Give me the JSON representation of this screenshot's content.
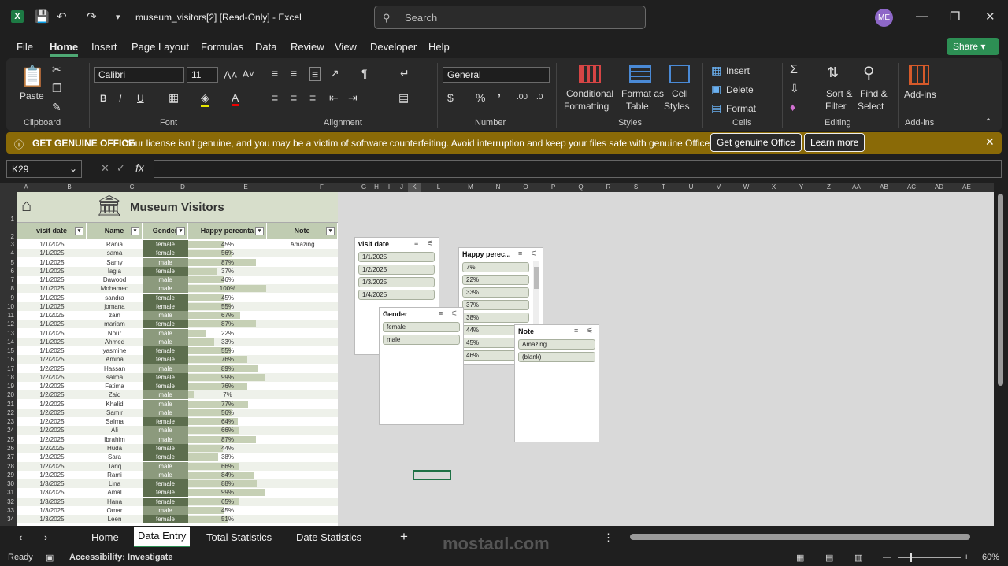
{
  "app": {
    "title": "museum_visitors[2]  [Read-Only]  -  Excel",
    "user_initials": "ME",
    "search_placeholder": "Search"
  },
  "menu": [
    "File",
    "Home",
    "Insert",
    "Page Layout",
    "Formulas",
    "Data",
    "Review",
    "View",
    "Developer",
    "Help"
  ],
  "share_label": "Share",
  "ribbon": {
    "paste": "Paste",
    "font_name": "Calibri",
    "font_size": "11",
    "number_format": "General",
    "conditional": [
      "Conditional",
      "Formatting"
    ],
    "format_table": [
      "Format as",
      "Table"
    ],
    "cell_styles": [
      "Cell",
      "Styles"
    ],
    "insert": "Insert",
    "delete": "Delete",
    "format": "Format",
    "sort_filter": [
      "Sort &",
      "Filter"
    ],
    "find_select": [
      "Find &",
      "Select"
    ],
    "addins": "Add-ins",
    "groups": [
      "Clipboard",
      "Font",
      "Alignment",
      "Number",
      "Styles",
      "Cells",
      "Editing",
      "Add-ins"
    ]
  },
  "infobar": {
    "title": "GET GENUINE OFFICE",
    "message": "Your license isn't genuine, and you may be a victim of software counterfeiting. Avoid interruption and keep your files safe with genuine Office today.",
    "get_btn": "Get genuine Office",
    "learn_btn": "Learn more"
  },
  "namebox": "K29",
  "columns": [
    "A",
    "B",
    "C",
    "D",
    "E",
    "F",
    "G",
    "H",
    "I",
    "J",
    "K",
    "L",
    "M",
    "N",
    "O",
    "P",
    "Q",
    "R",
    "S",
    "T",
    "U",
    "V",
    "W",
    "X",
    "Y",
    "Z",
    "AA",
    "AB",
    "AC",
    "AD",
    "AE"
  ],
  "sheet_title": "Museum  Visitors",
  "headers": [
    "visit date",
    "Name",
    "Gender",
    "Happy perecnta",
    "Note"
  ],
  "rows": [
    [
      "1/1/2025",
      "Rania",
      "female",
      45,
      "Amazing"
    ],
    [
      "1/1/2025",
      "sama",
      "female",
      56,
      ""
    ],
    [
      "1/1/2025",
      "Samy",
      "male",
      87,
      ""
    ],
    [
      "1/1/2025",
      "lagla",
      "female",
      37,
      ""
    ],
    [
      "1/1/2025",
      "Dawood",
      "male",
      46,
      ""
    ],
    [
      "1/1/2025",
      "Mohamed",
      "male",
      100,
      ""
    ],
    [
      "1/1/2025",
      "sandra",
      "female",
      45,
      ""
    ],
    [
      "1/1/2025",
      "jomana",
      "female",
      55,
      ""
    ],
    [
      "1/1/2025",
      "zain",
      "male",
      67,
      ""
    ],
    [
      "1/1/2025",
      "mariam",
      "female",
      87,
      ""
    ],
    [
      "1/1/2025",
      "Nour",
      "male",
      22,
      ""
    ],
    [
      "1/1/2025",
      "Ahmed",
      "male",
      33,
      ""
    ],
    [
      "1/1/2025",
      "yasmine",
      "female",
      55,
      ""
    ],
    [
      "1/2/2025",
      "Amina",
      "female",
      76,
      ""
    ],
    [
      "1/2/2025",
      "Hassan",
      "male",
      89,
      ""
    ],
    [
      "1/2/2025",
      "salma",
      "female",
      99,
      ""
    ],
    [
      "1/2/2025",
      "Fatima",
      "female",
      76,
      ""
    ],
    [
      "1/2/2025",
      "Zaid",
      "male",
      7,
      ""
    ],
    [
      "1/2/2025",
      "Khalid",
      "male",
      77,
      ""
    ],
    [
      "1/2/2025",
      "Samir",
      "male",
      56,
      ""
    ],
    [
      "1/2/2025",
      "Salma",
      "female",
      64,
      ""
    ],
    [
      "1/2/2025",
      "Ali",
      "male",
      66,
      ""
    ],
    [
      "1/2/2025",
      "Ibrahim",
      "male",
      87,
      ""
    ],
    [
      "1/2/2025",
      "Huda",
      "female",
      44,
      ""
    ],
    [
      "1/2/2025",
      "Sara",
      "female",
      38,
      ""
    ],
    [
      "1/2/2025",
      "Tariq",
      "male",
      66,
      ""
    ],
    [
      "1/2/2025",
      "Rami",
      "male",
      84,
      ""
    ],
    [
      "1/3/2025",
      "Lina",
      "female",
      88,
      ""
    ],
    [
      "1/3/2025",
      "Amal",
      "female",
      99,
      ""
    ],
    [
      "1/3/2025",
      "Hana",
      "female",
      65,
      ""
    ],
    [
      "1/3/2025",
      "Omar",
      "male",
      45,
      ""
    ],
    [
      "1/3/2025",
      "Leen",
      "female",
      51,
      ""
    ]
  ],
  "slicers": {
    "visit_date": {
      "title": "visit date",
      "items": [
        "1/1/2025",
        "1/2/2025",
        "1/3/2025",
        "1/4/2025"
      ]
    },
    "gender": {
      "title": "Gender",
      "items": [
        "female",
        "male"
      ]
    },
    "happy": {
      "title": "Happy perec...",
      "items": [
        "7%",
        "22%",
        "33%",
        "37%",
        "38%",
        "44%",
        "45%",
        "46%"
      ]
    },
    "note": {
      "title": "Note",
      "items": [
        "Amazing",
        "(blank)"
      ]
    }
  },
  "tabs": [
    "Home",
    "Data Entry",
    "Total Statistics",
    "Date Statistics"
  ],
  "status": {
    "ready": "Ready",
    "accessibility": "Accessibility: Investigate",
    "zoom": "60%"
  },
  "watermark": "mostaql.com",
  "colors": {
    "accent": "#2d8f54",
    "female_fill": "#5d6e4e",
    "male_fill": "#8c9a7d",
    "bar": "#c6d0b5"
  }
}
